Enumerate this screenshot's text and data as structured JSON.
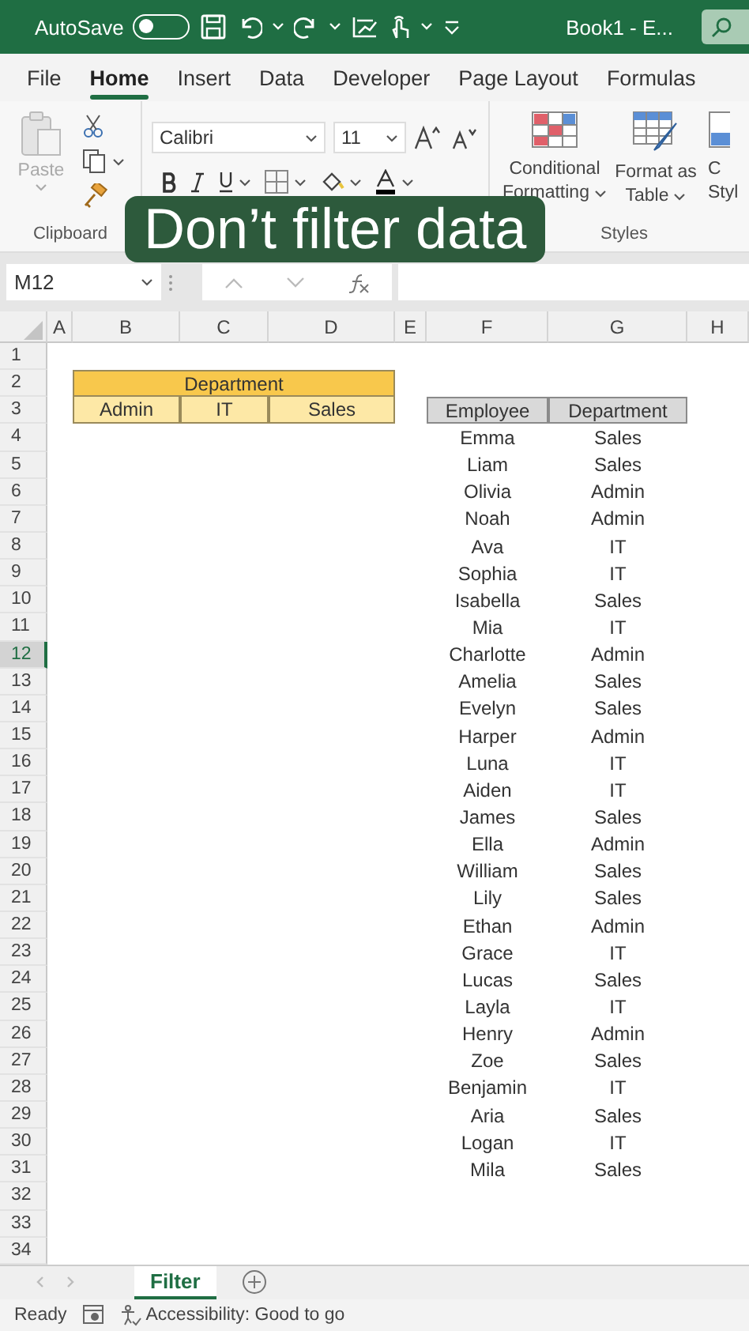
{
  "title_bar": {
    "autosave_label": "AutoSave",
    "autosave_on": false,
    "title": "Book1  -  E..."
  },
  "ribbon_tabs": [
    {
      "label": "File",
      "selected": false
    },
    {
      "label": "Home",
      "selected": true
    },
    {
      "label": "Insert",
      "selected": false
    },
    {
      "label": "Data",
      "selected": false
    },
    {
      "label": "Developer",
      "selected": false
    },
    {
      "label": "Page Layout",
      "selected": false
    },
    {
      "label": "Formulas",
      "selected": false
    }
  ],
  "ribbon": {
    "clipboard": {
      "paste_label": "Paste",
      "paste_disabled": true,
      "group_label": "Clipboard"
    },
    "font": {
      "font_name": "Calibri",
      "font_size": "11"
    },
    "styles": {
      "group_label": "Styles",
      "items": [
        {
          "kind": "conditional",
          "lines": [
            "Conditional",
            "Formatting"
          ]
        },
        {
          "kind": "table",
          "lines": [
            "Format as",
            "Table"
          ]
        },
        {
          "kind": "cell",
          "lines": [
            "C",
            "Styl"
          ]
        }
      ]
    }
  },
  "caption": "Don’t filter data",
  "formula_bar": {
    "name_box": "M12"
  },
  "sheet": {
    "columns": [
      "A",
      "B",
      "C",
      "D",
      "E",
      "F",
      "G",
      "H"
    ],
    "rows": [
      {
        "number": "1",
        "selected": false
      },
      {
        "number": "2",
        "selected": false,
        "cells": {
          "B": {
            "kind": "band",
            "text": "Department"
          }
        }
      },
      {
        "number": "3",
        "selected": false,
        "cells": {
          "B": {
            "kind": "subheader",
            "text": "Admin"
          },
          "C": {
            "kind": "subheader",
            "text": "IT"
          },
          "D": {
            "kind": "subheader",
            "text": "Sales"
          },
          "F": {
            "kind": "header",
            "text": "Employee"
          },
          "G": {
            "kind": "header",
            "text": "Department"
          }
        }
      },
      {
        "number": "4",
        "selected": false,
        "cells": {
          "F": {
            "kind": "plain",
            "text": "Emma"
          },
          "G": {
            "kind": "plain",
            "text": "Sales"
          }
        }
      },
      {
        "number": "5",
        "selected": false,
        "cells": {
          "F": {
            "kind": "plain",
            "text": "Liam"
          },
          "G": {
            "kind": "plain",
            "text": "Sales"
          }
        }
      },
      {
        "number": "6",
        "selected": false,
        "cells": {
          "F": {
            "kind": "plain",
            "text": "Olivia"
          },
          "G": {
            "kind": "plain",
            "text": "Admin"
          }
        }
      },
      {
        "number": "7",
        "selected": false,
        "cells": {
          "F": {
            "kind": "plain",
            "text": "Noah"
          },
          "G": {
            "kind": "plain",
            "text": "Admin"
          }
        }
      },
      {
        "number": "8",
        "selected": false,
        "cells": {
          "F": {
            "kind": "plain",
            "text": "Ava"
          },
          "G": {
            "kind": "plain",
            "text": "IT"
          }
        }
      },
      {
        "number": "9",
        "selected": false,
        "cells": {
          "F": {
            "kind": "plain",
            "text": "Sophia"
          },
          "G": {
            "kind": "plain",
            "text": "IT"
          }
        }
      },
      {
        "number": "10",
        "selected": false,
        "cells": {
          "F": {
            "kind": "plain",
            "text": "Isabella"
          },
          "G": {
            "kind": "plain",
            "text": "Sales"
          }
        }
      },
      {
        "number": "11",
        "selected": false,
        "cells": {
          "F": {
            "kind": "plain",
            "text": "Mia"
          },
          "G": {
            "kind": "plain",
            "text": "IT"
          }
        }
      },
      {
        "number": "12",
        "selected": true,
        "cells": {
          "F": {
            "kind": "plain",
            "text": "Charlotte"
          },
          "G": {
            "kind": "plain",
            "text": "Admin"
          }
        }
      },
      {
        "number": "13",
        "selected": false,
        "cells": {
          "F": {
            "kind": "plain",
            "text": "Amelia"
          },
          "G": {
            "kind": "plain",
            "text": "Sales"
          }
        }
      },
      {
        "number": "14",
        "selected": false,
        "cells": {
          "F": {
            "kind": "plain",
            "text": "Evelyn"
          },
          "G": {
            "kind": "plain",
            "text": "Sales"
          }
        }
      },
      {
        "number": "15",
        "selected": false,
        "cells": {
          "F": {
            "kind": "plain",
            "text": "Harper"
          },
          "G": {
            "kind": "plain",
            "text": "Admin"
          }
        }
      },
      {
        "number": "16",
        "selected": false,
        "cells": {
          "F": {
            "kind": "plain",
            "text": "Luna"
          },
          "G": {
            "kind": "plain",
            "text": "IT"
          }
        }
      },
      {
        "number": "17",
        "selected": false,
        "cells": {
          "F": {
            "kind": "plain",
            "text": "Aiden"
          },
          "G": {
            "kind": "plain",
            "text": "IT"
          }
        }
      },
      {
        "number": "18",
        "selected": false,
        "cells": {
          "F": {
            "kind": "plain",
            "text": "James"
          },
          "G": {
            "kind": "plain",
            "text": "Sales"
          }
        }
      },
      {
        "number": "19",
        "selected": false,
        "cells": {
          "F": {
            "kind": "plain",
            "text": "Ella"
          },
          "G": {
            "kind": "plain",
            "text": "Admin"
          }
        }
      },
      {
        "number": "20",
        "selected": false,
        "cells": {
          "F": {
            "kind": "plain",
            "text": "William"
          },
          "G": {
            "kind": "plain",
            "text": "Sales"
          }
        }
      },
      {
        "number": "21",
        "selected": false,
        "cells": {
          "F": {
            "kind": "plain",
            "text": "Lily"
          },
          "G": {
            "kind": "plain",
            "text": "Sales"
          }
        }
      },
      {
        "number": "22",
        "selected": false,
        "cells": {
          "F": {
            "kind": "plain",
            "text": "Ethan"
          },
          "G": {
            "kind": "plain",
            "text": "Admin"
          }
        }
      },
      {
        "number": "23",
        "selected": false,
        "cells": {
          "F": {
            "kind": "plain",
            "text": "Grace"
          },
          "G": {
            "kind": "plain",
            "text": "IT"
          }
        }
      },
      {
        "number": "24",
        "selected": false,
        "cells": {
          "F": {
            "kind": "plain",
            "text": "Lucas"
          },
          "G": {
            "kind": "plain",
            "text": "Sales"
          }
        }
      },
      {
        "number": "25",
        "selected": false,
        "cells": {
          "F": {
            "kind": "plain",
            "text": "Layla"
          },
          "G": {
            "kind": "plain",
            "text": "IT"
          }
        }
      },
      {
        "number": "26",
        "selected": false,
        "cells": {
          "F": {
            "kind": "plain",
            "text": "Henry"
          },
          "G": {
            "kind": "plain",
            "text": "Admin"
          }
        }
      },
      {
        "number": "27",
        "selected": false,
        "cells": {
          "F": {
            "kind": "plain",
            "text": "Zoe"
          },
          "G": {
            "kind": "plain",
            "text": "Sales"
          }
        }
      },
      {
        "number": "28",
        "selected": false,
        "cells": {
          "F": {
            "kind": "plain",
            "text": "Benjamin"
          },
          "G": {
            "kind": "plain",
            "text": "IT"
          }
        }
      },
      {
        "number": "29",
        "selected": false,
        "cells": {
          "F": {
            "kind": "plain",
            "text": "Aria"
          },
          "G": {
            "kind": "plain",
            "text": "Sales"
          }
        }
      },
      {
        "number": "30",
        "selected": false,
        "cells": {
          "F": {
            "kind": "plain",
            "text": "Logan"
          },
          "G": {
            "kind": "plain",
            "text": "IT"
          }
        }
      },
      {
        "number": "31",
        "selected": false,
        "cells": {
          "F": {
            "kind": "plain",
            "text": "Mila"
          },
          "G": {
            "kind": "plain",
            "text": "Sales"
          }
        }
      },
      {
        "number": "32",
        "selected": false
      },
      {
        "number": "33",
        "selected": false
      },
      {
        "number": "34",
        "selected": false
      }
    ]
  },
  "sheet_tabs": [
    {
      "label": "Filter",
      "selected": true
    }
  ],
  "status_bar": {
    "status": "Ready",
    "accessibility": "Accessibility: Good to go"
  }
}
